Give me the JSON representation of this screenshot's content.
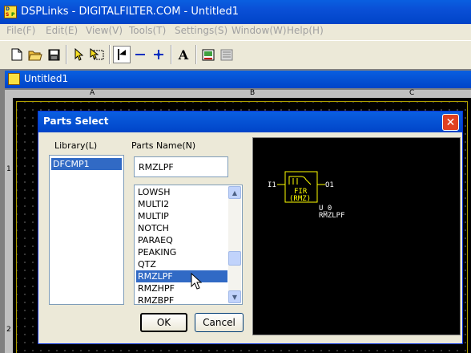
{
  "window": {
    "title": "DSPLinks - DIGITALFILTER.COM - Untitled1",
    "logo_text": "DSP"
  },
  "menubar": {
    "items": [
      "File(F)",
      "Edit(E)",
      "View(V)",
      "Tools(T)",
      "Settings(S)",
      "Window(W)",
      "Help(H)"
    ]
  },
  "toolbar": {
    "text_tool": "A"
  },
  "document": {
    "title": "Untitled1",
    "column_labels": [
      "A",
      "B",
      "C"
    ],
    "row_labels": [
      "1",
      "2"
    ]
  },
  "dialog": {
    "title": "Parts Select",
    "close_label": "✕",
    "library_label": "Library(L)",
    "library_items": [
      "DFCMP1"
    ],
    "parts_name_label": "Parts Name(N)",
    "parts_name_value": "RMZLPF",
    "parts_items": [
      "LOWSH",
      "MULTI2",
      "MULTIP",
      "NOTCH",
      "PARAEQ",
      "PEAKING",
      "QTZ",
      "RMZLPF",
      "RMZHPF",
      "RMZBPF"
    ],
    "selected_part": "RMZLPF",
    "ok_label": "OK",
    "cancel_label": "Cancel",
    "preview": {
      "input_pin": "I1",
      "output_pin": "O1",
      "block_line1": "FIR",
      "block_line2": "(RMZ)",
      "instance_name": "U_0",
      "part_name": "RMZLPF"
    }
  },
  "colors": {
    "selection": "#316ac5",
    "titlebar": "#0a4fd6",
    "symbol": "#ffff00",
    "frame": "#b0a000"
  }
}
